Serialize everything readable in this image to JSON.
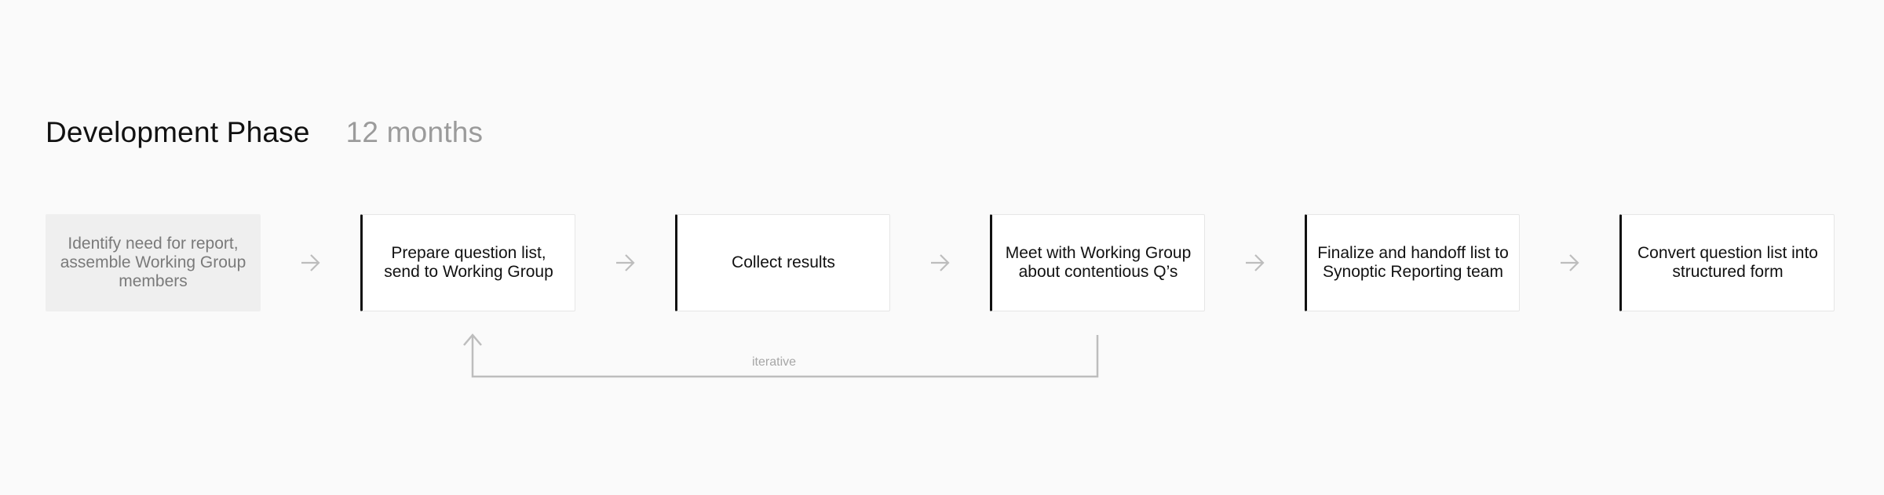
{
  "header": {
    "title": "Development Phase",
    "duration": "12 months"
  },
  "steps": [
    {
      "label": "Identify need for report, assemble Working Group members",
      "state": "inactive"
    },
    {
      "label": "Prepare question list, send to Working Group",
      "state": "active"
    },
    {
      "label": "Collect results",
      "state": "active"
    },
    {
      "label": "Meet with Working Group about contentious Q’s",
      "state": "active"
    },
    {
      "label": "Finalize and handoff list to Synoptic Reporting team",
      "state": "active"
    },
    {
      "label": "Convert question list into structured form",
      "state": "active"
    }
  ],
  "loop": {
    "label": "iterative",
    "from_step": 4,
    "to_step": 2
  },
  "colors": {
    "background": "#fafafa",
    "card": "#ffffff",
    "card_muted": "#efefef",
    "accent_border": "#111111",
    "arrow": "#bdbdbd",
    "secondary_text": "#9b9b9b"
  },
  "icons": {
    "arrow": "arrow-right-icon",
    "loop_head": "arrow-up-icon"
  }
}
